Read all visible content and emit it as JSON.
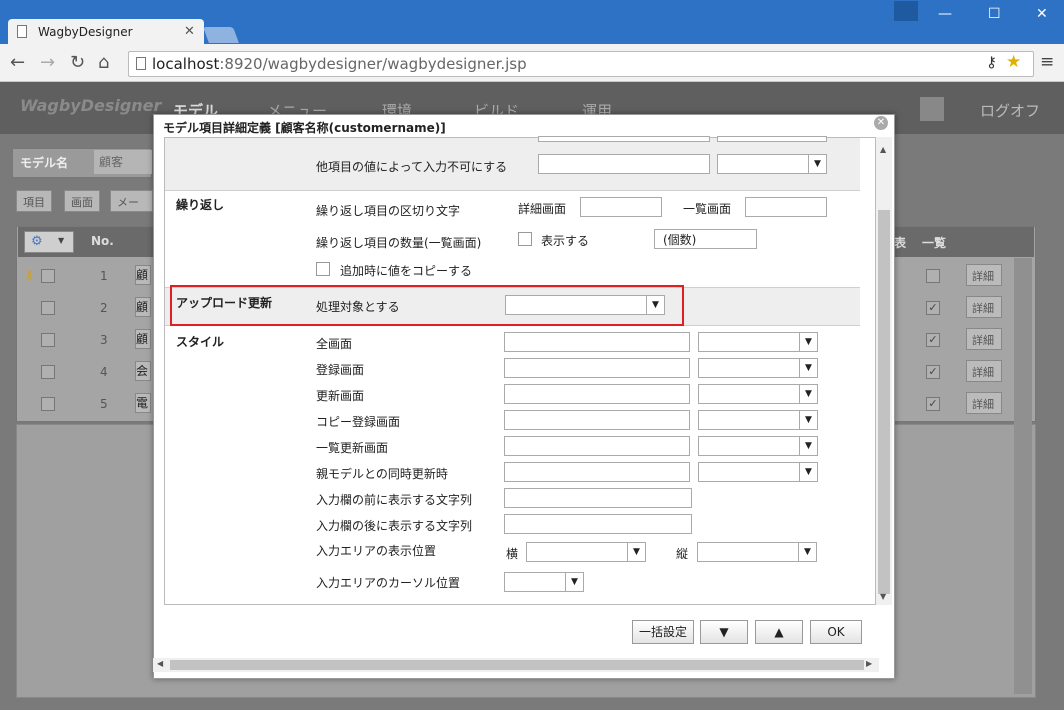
{
  "browser": {
    "tab_title": "WagbyDesigner",
    "url": "localhost:8920/wagbydesigner/wagbydesigner.jsp",
    "url_host": "localhost",
    "url_rest": ":8920/wagbydesigner/wagbydesigner.jsp"
  },
  "app": {
    "logo": "WagbyDesigner",
    "nav": [
      "モデル",
      "メニュー",
      "環境",
      "ビルド",
      "運用"
    ],
    "logoff": "ログオフ",
    "model_name_label": "モデル名",
    "model_name_value": "顧客",
    "subtabs": [
      "項目",
      "画面",
      "メール"
    ],
    "grid_headers": {
      "no": "No.",
      "list": "一覧",
      "other": "表"
    },
    "rows": [
      {
        "no": "1",
        "field": "顧",
        "checked": false
      },
      {
        "no": "2",
        "field": "顧",
        "checked": true
      },
      {
        "no": "3",
        "field": "顧",
        "checked": true
      },
      {
        "no": "4",
        "field": "会",
        "checked": true
      },
      {
        "no": "5",
        "field": "電",
        "checked": true
      }
    ],
    "detail_label": "詳細"
  },
  "dialog": {
    "title": "モデル項目詳細定義 [顧客名称(customername)]",
    "disable_by_other_label": "他項目の値によって入力不可にする",
    "repeat": {
      "section": "繰り返し",
      "delimiter_label": "繰り返し項目の区切り文字",
      "detail_screen": "詳細画面",
      "list_screen": "一覧画面",
      "count_label": "繰り返し項目の数量(一覧画面)",
      "show_label": "表示する",
      "count_unit": "(個数)",
      "copy_label": "追加時に値をコピーする"
    },
    "upload": {
      "section": "アップロード更新",
      "process_label": "処理対象とする"
    },
    "style": {
      "section": "スタイル",
      "rows": [
        "全画面",
        "登録画面",
        "更新画面",
        "コピー登録画面",
        "一覧更新画面",
        "親モデルとの同時更新時"
      ],
      "before_text": "入力欄の前に表示する文字列",
      "after_text": "入力欄の後に表示する文字列",
      "area_pos": "入力エリアの表示位置",
      "horizontal": "横",
      "vertical": "縦",
      "cursor_pos": "入力エリアのカーソル位置"
    },
    "buttons": {
      "bulk": "一括設定",
      "down": "▼",
      "up": "▲",
      "ok": "OK"
    }
  }
}
